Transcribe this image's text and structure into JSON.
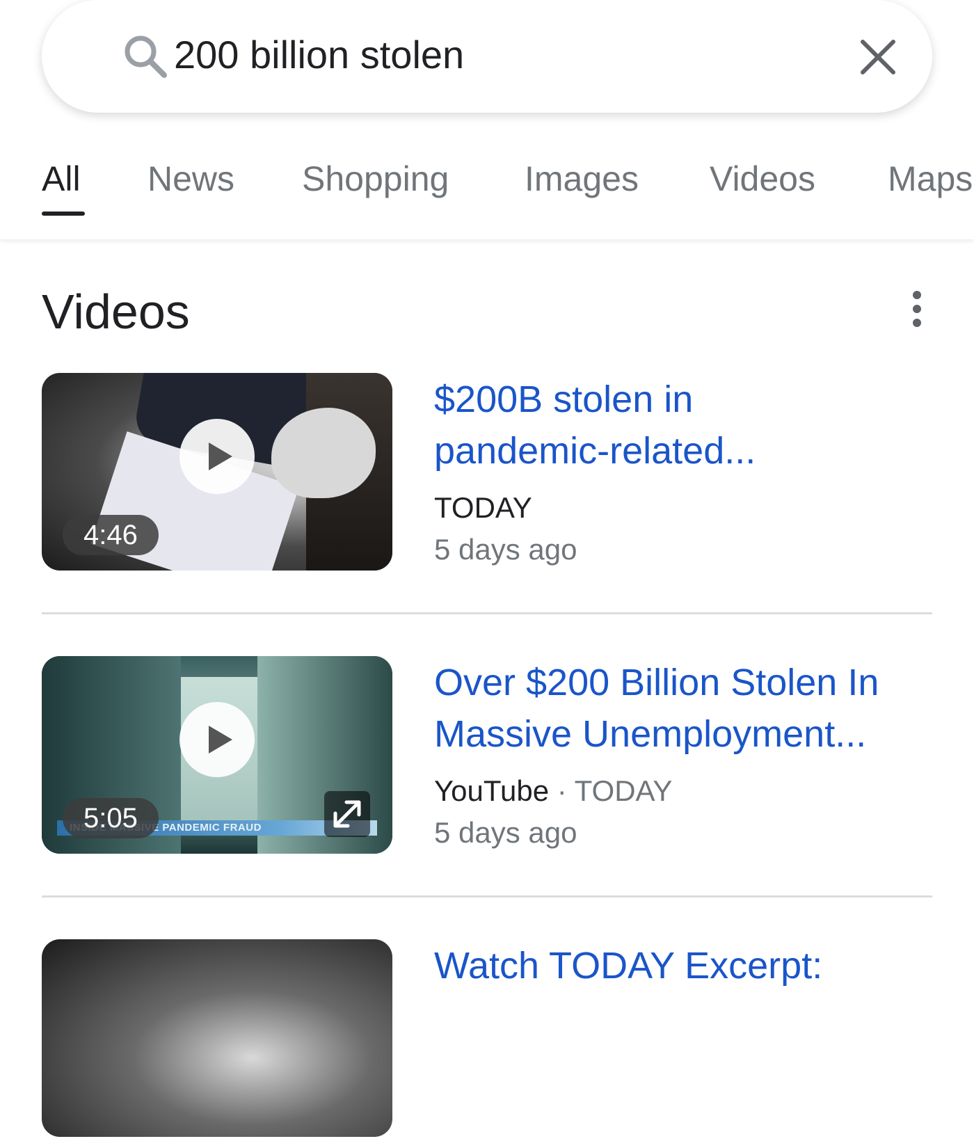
{
  "search": {
    "query": "200 billion stolen",
    "search_icon": "search-icon",
    "clear_icon": "close-icon"
  },
  "tabs": [
    {
      "label": "All",
      "active": true
    },
    {
      "label": "News",
      "active": false
    },
    {
      "label": "Shopping",
      "active": false
    },
    {
      "label": "Images",
      "active": false
    },
    {
      "label": "Videos",
      "active": false
    },
    {
      "label": "Maps",
      "active": false
    }
  ],
  "videos_section": {
    "title": "Videos",
    "more_icon": "more-vert-icon",
    "items": [
      {
        "title_line1": "$200B stolen in",
        "title_line2": "pandemic-related...",
        "source": "TODAY",
        "age": "5 days ago",
        "duration": "4:46"
      },
      {
        "title_line1": "Over $200 Billion Stolen In",
        "title_line2": "Massive Unemployment...",
        "source": "YouTube",
        "separator": "·",
        "publisher": "TODAY",
        "age": "5 days ago",
        "duration": "5:05",
        "thumbnail_caption": "INSIDE MASSIVE PANDEMIC FRAUD"
      },
      {
        "title_line1": "Watch TODAY Excerpt:"
      }
    ]
  },
  "colors": {
    "link": "#1a55c9",
    "text": "#202124",
    "muted": "#70757a",
    "divider": "#dadce0"
  }
}
